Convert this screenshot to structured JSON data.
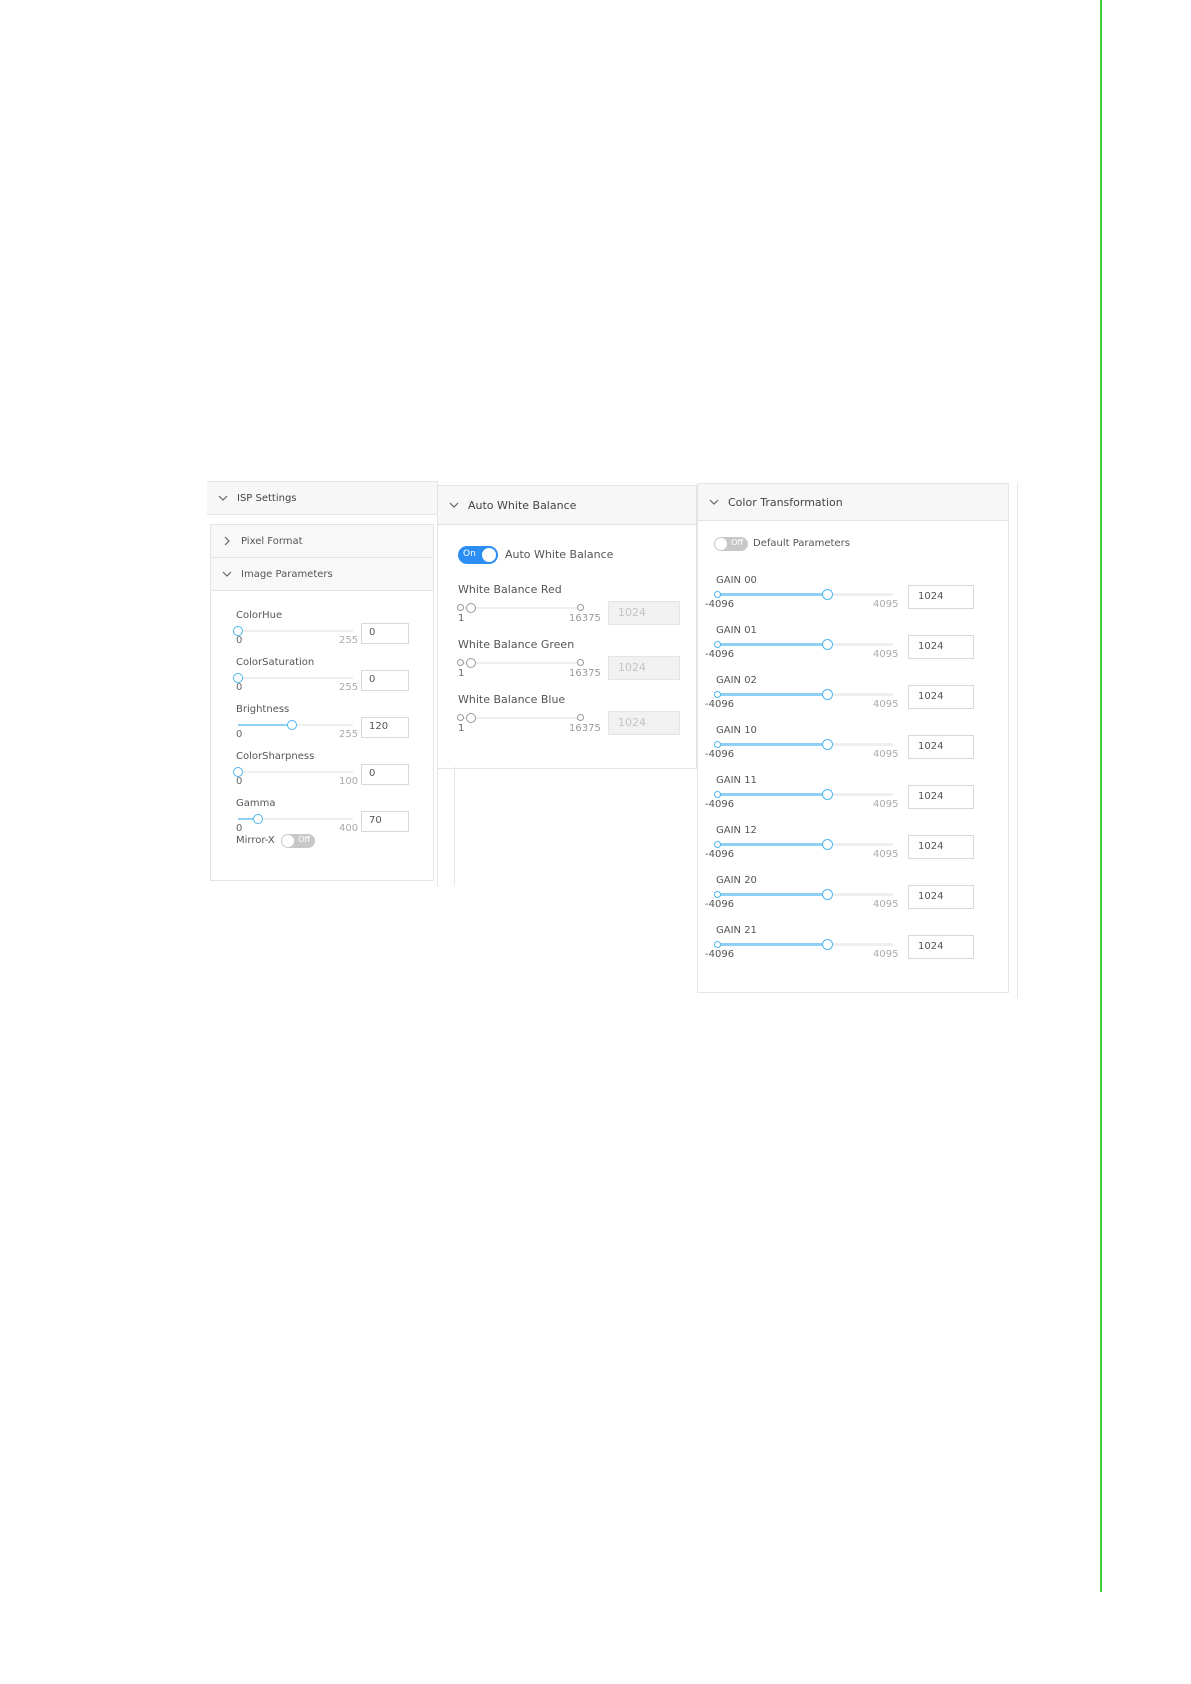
{
  "isp": {
    "title": "ISP Settings",
    "pixel_format": "Pixel Format",
    "image_parameters": "Image Parameters",
    "params": [
      {
        "label": "ColorHue",
        "min": "0",
        "max": "255",
        "value": "0",
        "fraction": 0
      },
      {
        "label": "ColorSaturation",
        "min": "0",
        "max": "255",
        "value": "0",
        "fraction": 0
      },
      {
        "label": "Brightness",
        "min": "0",
        "max": "255",
        "value": "120",
        "fraction": 0.47
      },
      {
        "label": "ColorSharpness",
        "min": "0",
        "max": "100",
        "value": "0",
        "fraction": 0
      },
      {
        "label": "Gamma",
        "min": "0",
        "max": "400",
        "value": "70",
        "fraction": 0.175
      }
    ],
    "mirror_x": {
      "label": "Mirror-X",
      "state": "Off"
    }
  },
  "awb": {
    "title": "Auto White Balance",
    "toggle_state": "On",
    "toggle_label": "Auto White Balance",
    "rows": [
      {
        "label": "White Balance Red",
        "min": "1",
        "max": "16375",
        "value": "1024"
      },
      {
        "label": "White Balance Green",
        "min": "1",
        "max": "16375",
        "value": "1024"
      },
      {
        "label": "White Balance Blue",
        "min": "1",
        "max": "16375",
        "value": "1024"
      }
    ]
  },
  "ct": {
    "title": "Color Transformation",
    "default_params": {
      "state": "Off",
      "label": "Default Parameters"
    },
    "gains": [
      {
        "label": "GAIN 00",
        "min": "-4096",
        "max": "4095",
        "value": "1024",
        "fraction": 0.625
      },
      {
        "label": "GAIN 01",
        "min": "-4096",
        "max": "4095",
        "value": "1024",
        "fraction": 0.625
      },
      {
        "label": "GAIN 02",
        "min": "-4096",
        "max": "4095",
        "value": "1024",
        "fraction": 0.625
      },
      {
        "label": "GAIN 10",
        "min": "-4096",
        "max": "4095",
        "value": "1024",
        "fraction": 0.625
      },
      {
        "label": "GAIN 11",
        "min": "-4096",
        "max": "4095",
        "value": "1024",
        "fraction": 0.625
      },
      {
        "label": "GAIN 12",
        "min": "-4096",
        "max": "4095",
        "value": "1024",
        "fraction": 0.625
      },
      {
        "label": "GAIN 20",
        "min": "-4096",
        "max": "4095",
        "value": "1024",
        "fraction": 0.625
      },
      {
        "label": "GAIN 21",
        "min": "-4096",
        "max": "4095",
        "value": "1024",
        "fraction": 0.625
      }
    ]
  },
  "colors": {
    "accent": "#2a8ef4",
    "slider_fill": "#8fd0f5",
    "page_marker": "#3ed13b"
  }
}
